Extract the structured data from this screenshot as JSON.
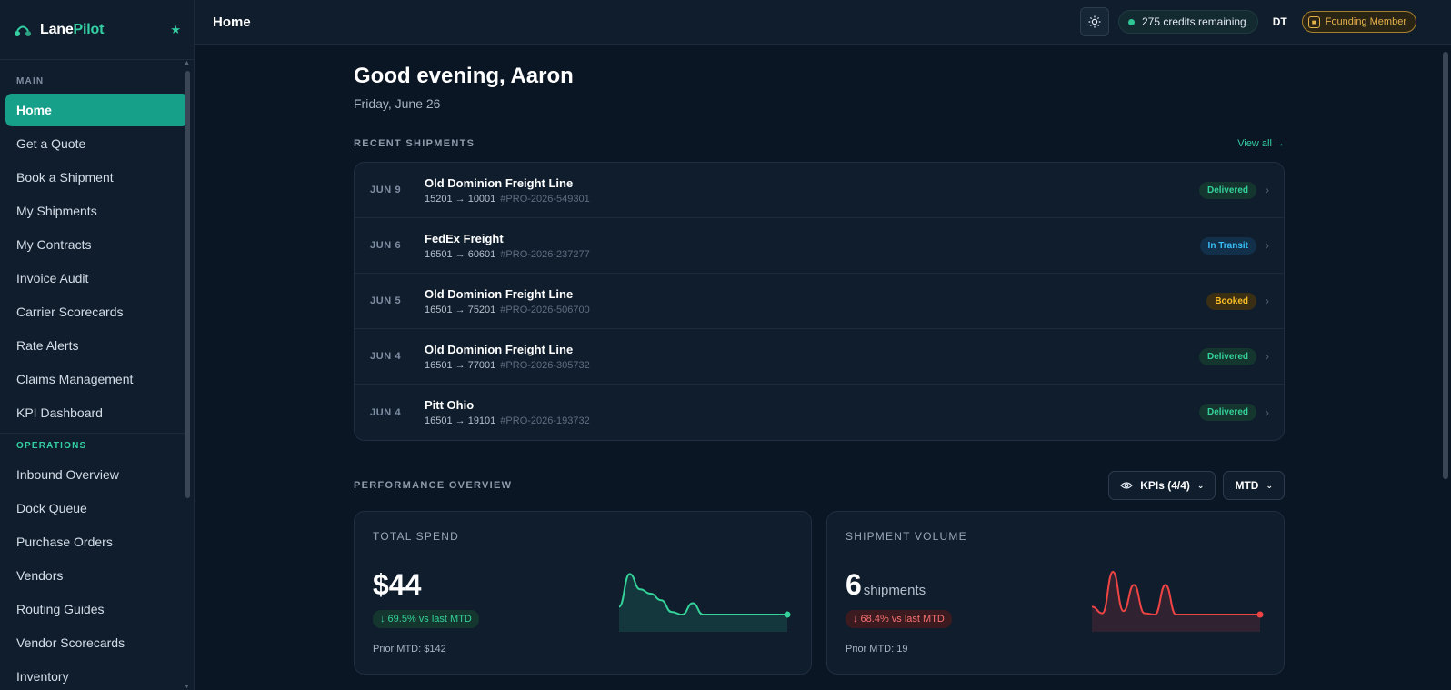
{
  "brand": {
    "name_part1": "Lane",
    "name_part2": "Pilot"
  },
  "sidebar": {
    "sections": [
      {
        "label": "MAIN",
        "items": [
          "Home",
          "Get a Quote",
          "Book a Shipment",
          "My Shipments",
          "My Contracts",
          "Invoice Audit",
          "Carrier Scorecards",
          "Rate Alerts",
          "Claims Management",
          "KPI Dashboard"
        ]
      },
      {
        "label": "OPERATIONS",
        "items": [
          "Inbound Overview",
          "Dock Queue",
          "Purchase Orders",
          "Vendors",
          "Routing Guides",
          "Vendor Scorecards",
          "Inventory"
        ]
      }
    ],
    "active_item": "Home"
  },
  "topbar": {
    "title": "Home",
    "credits": "275 credits remaining",
    "avatar": "DT",
    "member_badge": "Founding Member"
  },
  "main": {
    "greeting": "Good evening, Aaron",
    "date": "Friday, June 26",
    "recent_label": "RECENT SHIPMENTS",
    "view_all": "View all →",
    "shipments": [
      {
        "date": "JUN 9",
        "carrier": "Old Dominion Freight Line",
        "route": "15201 → 10001",
        "pro": "#PRO-2026-549301",
        "status": "Delivered",
        "status_kind": "delivered"
      },
      {
        "date": "JUN 6",
        "carrier": "FedEx Freight",
        "route": "16501 → 60601",
        "pro": "#PRO-2026-237277",
        "status": "In Transit",
        "status_kind": "transit"
      },
      {
        "date": "JUN 5",
        "carrier": "Old Dominion Freight Line",
        "route": "16501 → 75201",
        "pro": "#PRO-2026-506700",
        "status": "Booked",
        "status_kind": "booked"
      },
      {
        "date": "JUN 4",
        "carrier": "Old Dominion Freight Line",
        "route": "16501 → 77001",
        "pro": "#PRO-2026-305732",
        "status": "Delivered",
        "status_kind": "delivered"
      },
      {
        "date": "JUN 4",
        "carrier": "Pitt Ohio",
        "route": "16501 → 19101",
        "pro": "#PRO-2026-193732",
        "status": "Delivered",
        "status_kind": "delivered"
      }
    ],
    "performance_label": "PERFORMANCE OVERVIEW",
    "kpi_select": "KPIs (4/4)",
    "period_select": "MTD",
    "cards": [
      {
        "label": "TOTAL SPEND",
        "value": "$44",
        "unit": "",
        "delta": "↓ 69.5% vs last MTD",
        "delta_kind": "green",
        "prior": "Prior MTD: $142",
        "color": "#34d399",
        "trend": [
          0.2,
          0.95,
          0.6,
          0.5,
          0.35,
          0.08,
          0.02,
          0.28,
          0.02,
          0.02,
          0.02,
          0.02,
          0.02,
          0.02,
          0.02,
          0.02,
          0.02
        ]
      },
      {
        "label": "SHIPMENT VOLUME",
        "value": "6",
        "unit": "shipments",
        "delta": "↓ 68.4% vs last MTD",
        "delta_kind": "red",
        "prior": "Prior MTD: 19",
        "color": "#ef4444",
        "trend": [
          0.2,
          0.05,
          1.0,
          0.1,
          0.7,
          0.05,
          0.02,
          0.7,
          0.02,
          0.02,
          0.02,
          0.02,
          0.02,
          0.02,
          0.02,
          0.02,
          0.02
        ]
      }
    ]
  }
}
